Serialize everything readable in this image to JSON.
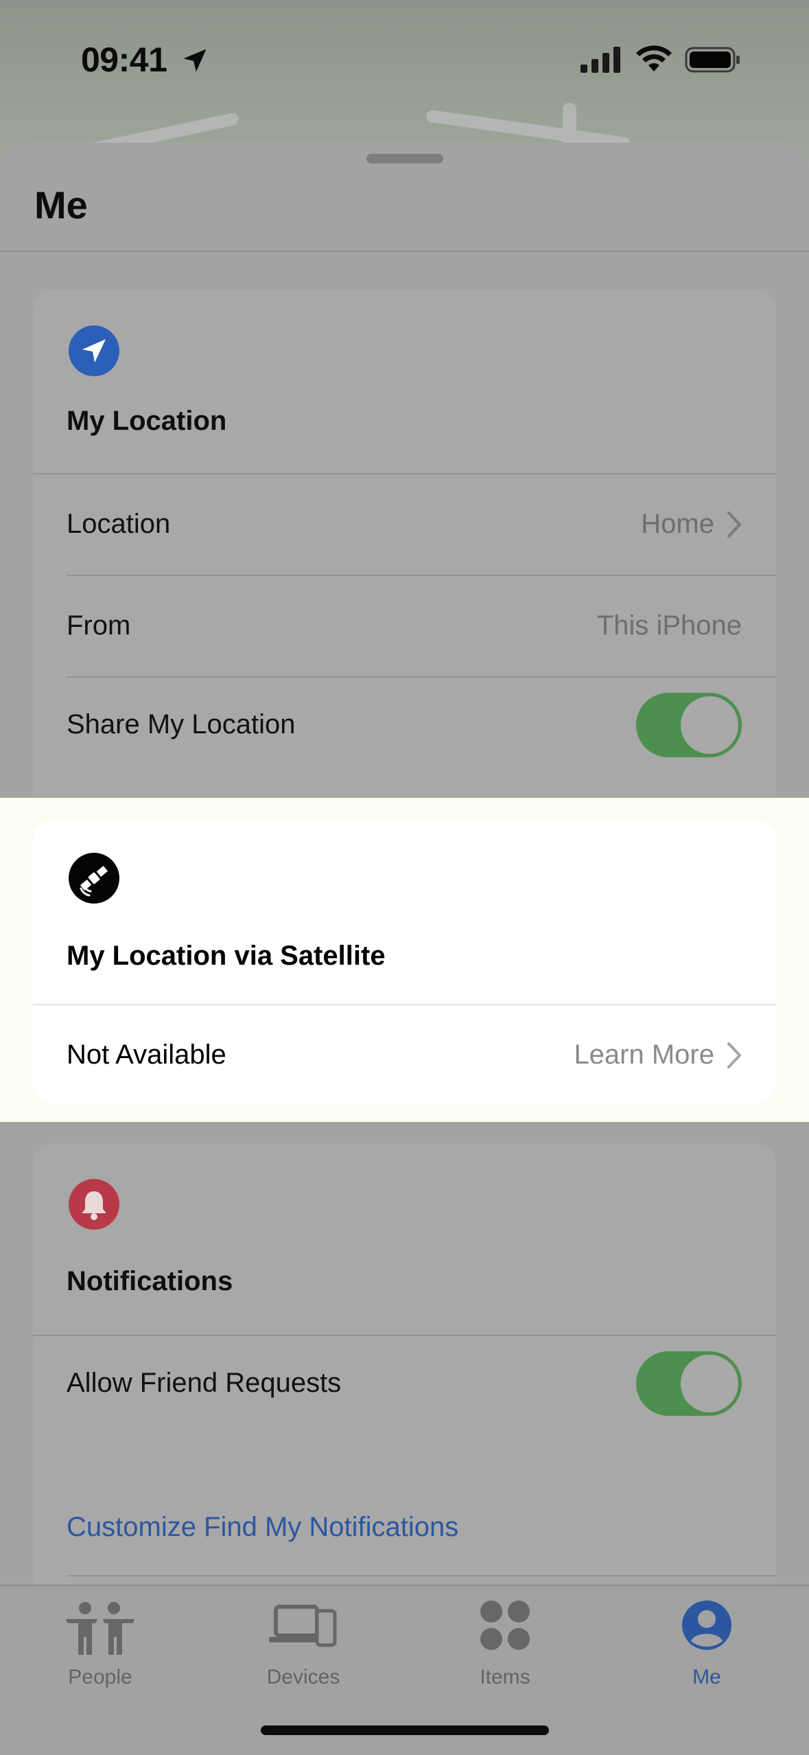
{
  "status_bar": {
    "time": "09:41",
    "icons": [
      "location-arrow-icon",
      "cellular-signal-icon",
      "wifi-icon",
      "battery-icon"
    ]
  },
  "sheet": {
    "title": "Me"
  },
  "my_location": {
    "icon": "location-arrow-icon",
    "heading": "My Location",
    "rows": {
      "location": {
        "label": "Location",
        "value": "Home"
      },
      "from": {
        "label": "From",
        "value": "This iPhone"
      },
      "share": {
        "label": "Share My Location",
        "enabled": true
      }
    }
  },
  "satellite": {
    "icon": "satellite-icon",
    "heading": "My Location via Satellite",
    "status": "Not Available",
    "link": "Learn More"
  },
  "notifications": {
    "icon": "bell-icon",
    "heading": "Notifications",
    "allow_friend_requests": {
      "label": "Allow Friend Requests",
      "enabled": true
    },
    "customize_link": "Customize Find My Notifications"
  },
  "tab_bar": {
    "tabs": [
      {
        "label": "People",
        "icon": "people-icon",
        "active": false
      },
      {
        "label": "Devices",
        "icon": "devices-icon",
        "active": false
      },
      {
        "label": "Items",
        "icon": "items-icon",
        "active": false
      },
      {
        "label": "Me",
        "icon": "person-circle-icon",
        "active": true
      }
    ]
  },
  "colors": {
    "accent_blue": "#2c57a0",
    "toggle_green": "#4d8f4f",
    "bell_red": "#b83a48",
    "location_blue": "#2b5fb8"
  }
}
